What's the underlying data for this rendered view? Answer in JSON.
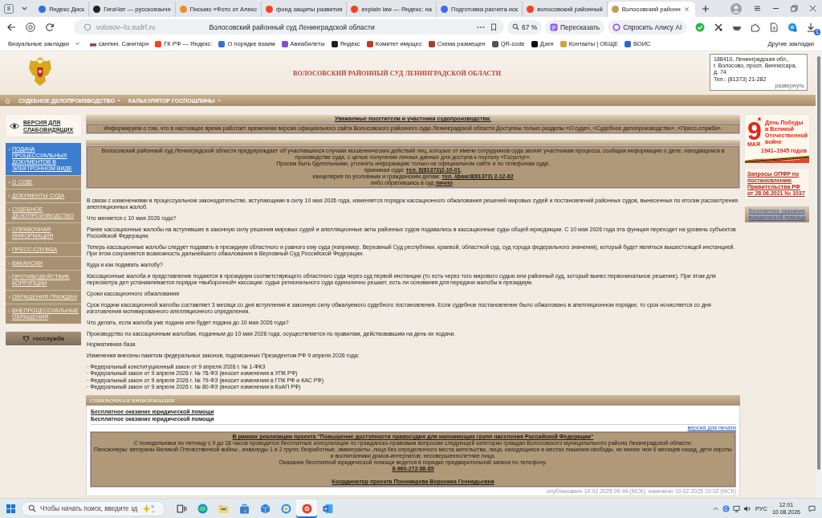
{
  "browser": {
    "tab_counter": "8",
    "tabs": [
      {
        "title": "Яндекс Диск",
        "color": "#2f6fe0",
        "selected": false
      },
      {
        "title": "ГигаЧат — русскоязычн",
        "color": "#222222",
        "selected": false
      },
      {
        "title": "Письмо «Фото от Алекс",
        "color": "#f28c28",
        "selected": false
      },
      {
        "title": "фонд защиты развития",
        "color": "#fc3f1d",
        "selected": false
      },
      {
        "title": "explain law — Яндекс: на",
        "color": "#fc3f1d",
        "selected": false
      },
      {
        "title": "Подготовка расчета иск",
        "color": "#3d6ee0",
        "selected": false
      },
      {
        "title": "волосовский районный",
        "color": "#fc3f1d",
        "selected": false
      },
      {
        "title": "Волосовский районн",
        "color": "#c59b5a",
        "selected": true
      }
    ],
    "address_bar": {
      "url": "volosov--lo.sudrf.ru",
      "page_title": "Волосовский районный суд Ленинградской области"
    },
    "zoom": "67 %",
    "actions": [
      {
        "kind": "retell",
        "label": "Пересказать"
      },
      {
        "kind": "assistant",
        "label": "Спросить Алису AI"
      }
    ],
    "download_count": "1",
    "bookmarks": {
      "menu": "Визуальные закладки",
      "items": [
        {
          "kind": "flag",
          "label": "санпин. Санитарн"
        },
        {
          "kind": "site",
          "label": "ГК РФ — Яндекс:",
          "color": "#fc3f1d"
        },
        {
          "kind": "site",
          "label": "О порядке взаим",
          "color": "#3a6fd8"
        },
        {
          "kind": "site",
          "label": "Авиабилеты",
          "color": "#7b4fd6"
        },
        {
          "kind": "site",
          "label": "Яндекс",
          "color": "#1f1f1f"
        },
        {
          "kind": "site",
          "label": "Комитет имущес",
          "color": "#c0392b"
        },
        {
          "kind": "site",
          "label": "Схема размещен",
          "color": "#b03a2e"
        },
        {
          "kind": "site",
          "label": "QR-code",
          "color": "#555555"
        },
        {
          "kind": "site",
          "label": "Дзен",
          "color": "#111111"
        },
        {
          "kind": "site",
          "label": "Контакты | ОБЩЕ",
          "color": "#d4a23a"
        },
        {
          "kind": "site",
          "label": "ВОИС",
          "color": "#2d6ac8"
        }
      ],
      "other": "Другие закладки"
    }
  },
  "site": {
    "header": {
      "title": "ВОЛОСОВСКИЙ РАЙОННЫЙ СУД ЛЕНИНГРАДСКОЙ ОБЛАСТИ",
      "address_lines": [
        "188410, Ленинградская обл.,",
        "г. Волосово, просп. Вингиссара,",
        "д. 74",
        "Тел.: (81373) 21-282"
      ],
      "address_toggle": "развернуть"
    },
    "nav": [
      "СУДЕБНОЕ ДЕЛОПРОИЗВОДСТВО",
      "КАЛЬКУЛЯТОР ГОСПОШЛИНЫ"
    ],
    "accessibility_link": "ВЕРСИЯ ДЛЯ СЛАБОВИДЯЩИХ",
    "menu": [
      {
        "label": "ПОДАЧА ПРОЦЕССУАЛЬНЫХ ДОКУМЕНТОВ В ЭЛЕКТРОННОМ ВИДЕ",
        "selected": true
      },
      {
        "label": "О СУДЕ",
        "selected": false
      },
      {
        "label": "ДОКУМЕНТЫ СУДА",
        "selected": false
      },
      {
        "label": "СУДЕБНОЕ ДЕЛОПРОИЗВОДСТВО",
        "selected": false
      },
      {
        "label": "СПРАВОЧНАЯ ИНФОРМАЦИЯ",
        "selected": false
      },
      {
        "label": "ПРЕСС-СЛУЖБА",
        "selected": false
      },
      {
        "label": "ВАКАНСИИ",
        "selected": false
      },
      {
        "label": "ПРОТИВОДЕЙСТВИЕ КОРРУПЦИИ",
        "selected": false
      },
      {
        "label": "ОБРАЩЕНИЯ ГРАЖДАН",
        "selected": false
      },
      {
        "label": "ВНЕПРОЦЕССУАЛЬНЫЕ ОБРАЩЕНИЯ",
        "selected": false
      }
    ],
    "civil_service_button": "госслужба",
    "notices": [
      {
        "title": "Уважаемые посетители и участники судопроизводства:",
        "lines": [
          {
            "text": "Информируем о том, что в настоящее время работает временная версия официального сайта Волосовского районного суда Ленинградской области.Доступны только разделы «О суде», «Судебное делопроизводство», «Пресс-служба»."
          }
        ]
      },
      {
        "lines": [
          {
            "text": "Волосовский районный суд Ленинградской области предупреждает об участившихся случаях мошеннических действий лиц, которые от имени сотрудников суда звонят участникам процесса, сообщая информацию о деле, находящемся в производстве суда, с целью получения личных данных для доступа к порталу «Госуслуг»."
          },
          {
            "text": "Просим быть бдительными, уточнять информацию только на официальном сайте и по телефонам суда:"
          },
          {
            "text": "приемная суда:",
            "link": "тел. 8(81373)2-10-01",
            "after": ","
          },
          {
            "text": "канцелярия по уголовным и гражданским делам:",
            "link": "тел. /факс8(81373) 2-12-82"
          },
          {
            "text": "либо обратившись в суд",
            "link": "лично",
            "after": " ."
          }
        ]
      }
    ],
    "article": {
      "paragraphs": [
        "В связи с изменениями в процессуальном законодательстве, вступающими в силу 10 мая 2026 года, изменяется порядок кассационного обжалования решений мировых судей и постановлений районных судов, вынесенных по итогам рассмотрения апелляционных жалоб.",
        "Что меняется с 10 мая 2026 года?",
        "Ранее кассационные жалобы на вступившие в законную силу решения мировых судей и апелляционные акты районных судов подавались в кассационные суды общей юрисдикции. С 10 мая 2026 года эта функция переходит на уровень субъектов Российской Федерации.",
        "Теперь кассационные жалобы следует подавать в президиум областного и равного ему суда (например, Верховный Суд республики, краевой, областной суд, суд города федерального значения), который будет являться вышестоящей инстанцией. При этом сохраняется возможность дальнейшего обжалования в Верховный Суд Российской Федерации.",
        "Куда и как подавать жалобу?",
        "Кассационные жалоба и представление подаются в президиум соответствующего областного суда через суд первой инстанции (то есть через того мирового судью или районный суд, который вынес первоначальное решение). При этом для пересмотра дел устанавливается порядок «выборочной» кассации: судья регионального суда единолично решает, есть ли основания для передачи жалобы в президиум.",
        "Сроки кассационного обжалования",
        "Срок подачи кассационной жалобы составляет 3 месяца со дня вступления в законную силу обжалуемого судебного постановления. Если судебное постановление было обжаловано в апелляционном порядке, то срок исчисляется со дня изготовления мотивированного апелляционного определения.",
        "Что делать, если жалоба уже подана или будет подана до 10 мая 2026 года?",
        "Производство по кассационным жалобам, поданным до 10 мая 2026 года, осуществляется по правилам, действовавшим на день их подачи.",
        "Нормативная база",
        "Изменения внесены пакетом федеральных законов, подписанных Президентом РФ 9 апреля 2026 года:"
      ],
      "laws": [
        "· Федеральный конституционный закон от 9 апреля 2026 г. № 1-ФКЗ",
        "· Федеральный закон от 9 апреля 2026 г. № 78-ФЗ (вносит изменения в УПК РФ)",
        "· Федеральный закон от 9 апреля 2026 г. № 79-ФЗ (вносит изменения в ГПК РФ и КАС РФ)",
        "· Федеральный закон от 9 апреля 2026 г. № 80-ФЗ (вносит изменения в КоАП РФ)"
      ]
    },
    "reference": {
      "title": "СПРАВОЧНАЯ ИНФОРМАЦИЯ",
      "link": "Бесплатное оказание юридической помощи",
      "heading": "Бесплатное оказание юридической помощи",
      "print_link": "версия для печати",
      "box": {
        "title": "В рамках реализации проекта \"Повышение доступности правосудия для малоимущих групп населения Российской Федерации\"",
        "lines": [
          "С понедельника по пятницу с 9 до 18 часов проводятся бесплатные консультации по гражданско-правовым вопросам следующей категории граждан Волосовского муниципального района Ленинградской области:",
          "Пенсионеры: ветераны Великой Отечественной войны , инвалиды 1 и 2 групп; безработные, иммигранты ,лица без определенного места жительства, лица, находящиеся в местах лишения свободы, не менее чем 6 месяцев назад, дети сироты и воспитанники домов-интернатов; несовершеннолетние лица.",
          "Оказание бесплатной юридической помощи ведется в порядке предварительной записи по телефону:"
        ],
        "phone": "8-960-272-88-85",
        "coordinator": "Координатор проекта Пономарева Вероника Геннадьевна"
      },
      "footer": "опубликовано 10.02.2025 09:44 (МСК), изменено 10.02.2025 10:02 (МСК)"
    },
    "sidebar": {
      "banner": {
        "day": "9",
        "month": "МАЯ",
        "caption": "День Победы в Великой Отечественной войне",
        "years": "1941–1945 годов"
      },
      "pfr_link": "Запросы ОПФР по постановлению Правительства РФ от 28.06.2021 № 1037",
      "legal_aid_button": "Бесплатное оказание юридической помощи"
    }
  },
  "taskbar": {
    "search": {
      "placeholder": "Чтобы начать поиск, введите зд"
    },
    "apps": [
      {
        "kind": "edge",
        "selected": false
      },
      {
        "kind": "explorer",
        "selected": false
      },
      {
        "kind": "store",
        "selected": false
      },
      {
        "kind": "app",
        "selected": false
      },
      {
        "kind": "ring",
        "selected": false
      },
      {
        "kind": "yandex",
        "selected": true
      },
      {
        "kind": "word",
        "selected": false
      }
    ],
    "language": "РУС",
    "time": "12:01",
    "date": "10.08.2026"
  }
}
